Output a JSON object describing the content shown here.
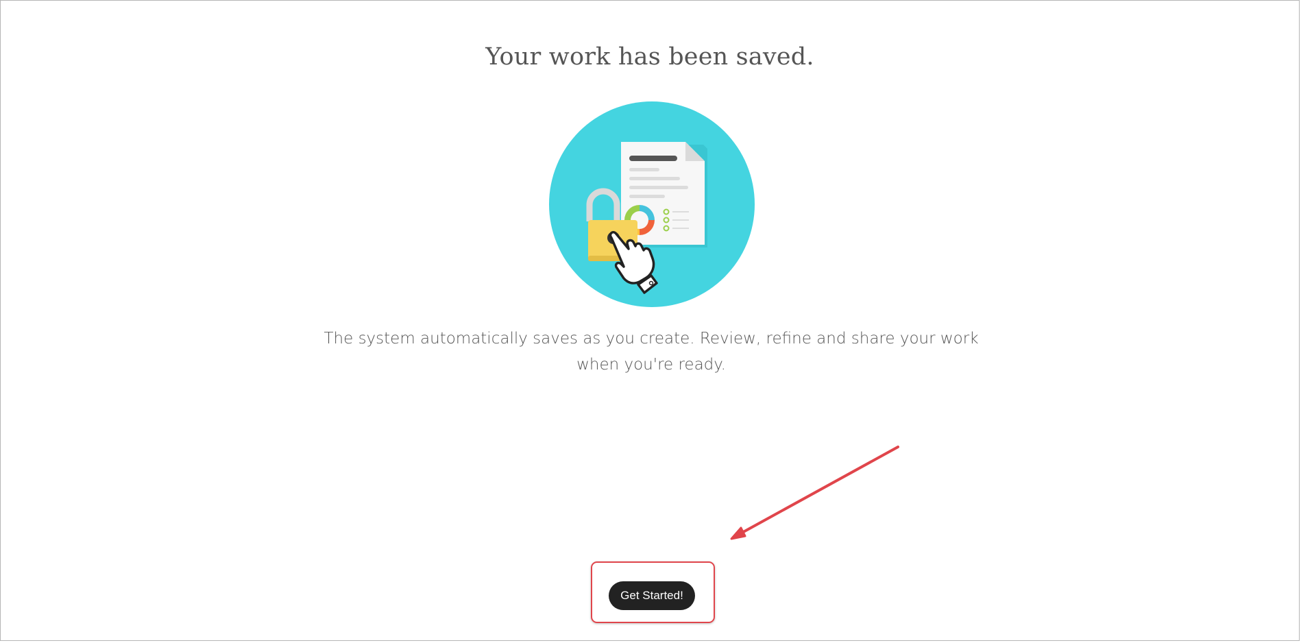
{
  "page": {
    "title": "Your work has been saved.",
    "description": "The system automatically saves as you create. Review, refine and share your work when you're ready."
  },
  "hero": {
    "icon": "secured-document-icon",
    "colors": {
      "circle": "#44d4e0",
      "lock": "#f6d35c",
      "shackle": "#d9d9d9",
      "chart": [
        "#45c3dd",
        "#f0623a",
        "#9bcf4a",
        "#ffc23d"
      ]
    }
  },
  "cta": {
    "label": "Get Started!",
    "highlight_color": "#e0454b"
  },
  "annotation": {
    "arrow_color": "#e0454b"
  }
}
